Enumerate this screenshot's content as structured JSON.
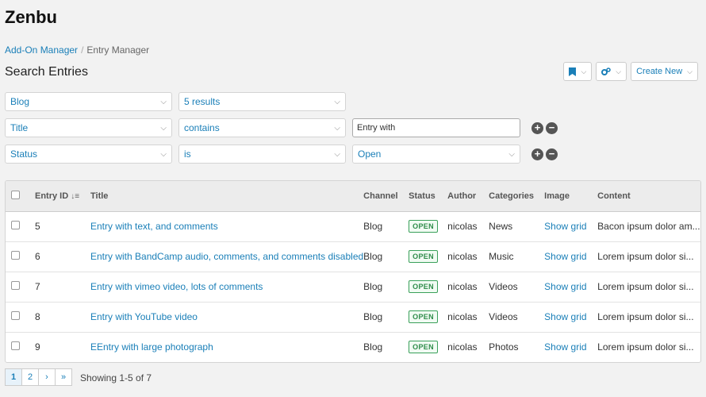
{
  "app": {
    "title": "Zenbu"
  },
  "breadcrumb": {
    "parent": "Add-On Manager",
    "separator": "/",
    "current": "Entry Manager"
  },
  "page": {
    "title": "Search Entries"
  },
  "toolbar": {
    "create_label": "Create New"
  },
  "filters": [
    {
      "field": "Blog",
      "operator": "5 results"
    },
    {
      "field": "Title",
      "operator": "contains",
      "value": "Entry with"
    },
    {
      "field": "Status",
      "operator": "is",
      "value": "Open"
    }
  ],
  "table": {
    "headers": {
      "id": "Entry ID",
      "title": "Title",
      "channel": "Channel",
      "status": "Status",
      "author": "Author",
      "categories": "Categories",
      "image": "Image",
      "content": "Content"
    },
    "rows": [
      {
        "id": "5",
        "title": "Entry with text, and comments",
        "channel": "Blog",
        "status": "OPEN",
        "author": "nicolas",
        "category": "News",
        "image": "Show grid",
        "content": "Bacon ipsum dolor am..."
      },
      {
        "id": "6",
        "title": "Entry with BandCamp audio, comments, and comments disabled",
        "channel": "Blog",
        "status": "OPEN",
        "author": "nicolas",
        "category": "Music",
        "image": "Show grid",
        "content": "Lorem ipsum dolor si..."
      },
      {
        "id": "7",
        "title": "Entry with vimeo video, lots of comments",
        "channel": "Blog",
        "status": "OPEN",
        "author": "nicolas",
        "category": "Videos",
        "image": "Show grid",
        "content": "Lorem ipsum dolor si..."
      },
      {
        "id": "8",
        "title": "Entry with YouTube video",
        "channel": "Blog",
        "status": "OPEN",
        "author": "nicolas",
        "category": "Videos",
        "image": "Show grid",
        "content": "Lorem ipsum dolor si..."
      },
      {
        "id": "9",
        "title": "EEntry with large photograph",
        "channel": "Blog",
        "status": "OPEN",
        "author": "nicolas",
        "category": "Photos",
        "image": "Show grid",
        "content": "Lorem ipsum dolor si..."
      }
    ]
  },
  "pagination": {
    "pages": [
      "1",
      "2"
    ],
    "next": "›",
    "last": "»",
    "info": "Showing 1-5 of 7"
  },
  "icons": {
    "bookmark": "bookmark-icon",
    "settings": "gears-icon",
    "add": "plus-circle-icon",
    "remove": "minus-circle-icon",
    "sort": "sort-numeric-icon"
  },
  "colors": {
    "link": "#1a7fb8",
    "status_open": "#2f8c4b"
  }
}
